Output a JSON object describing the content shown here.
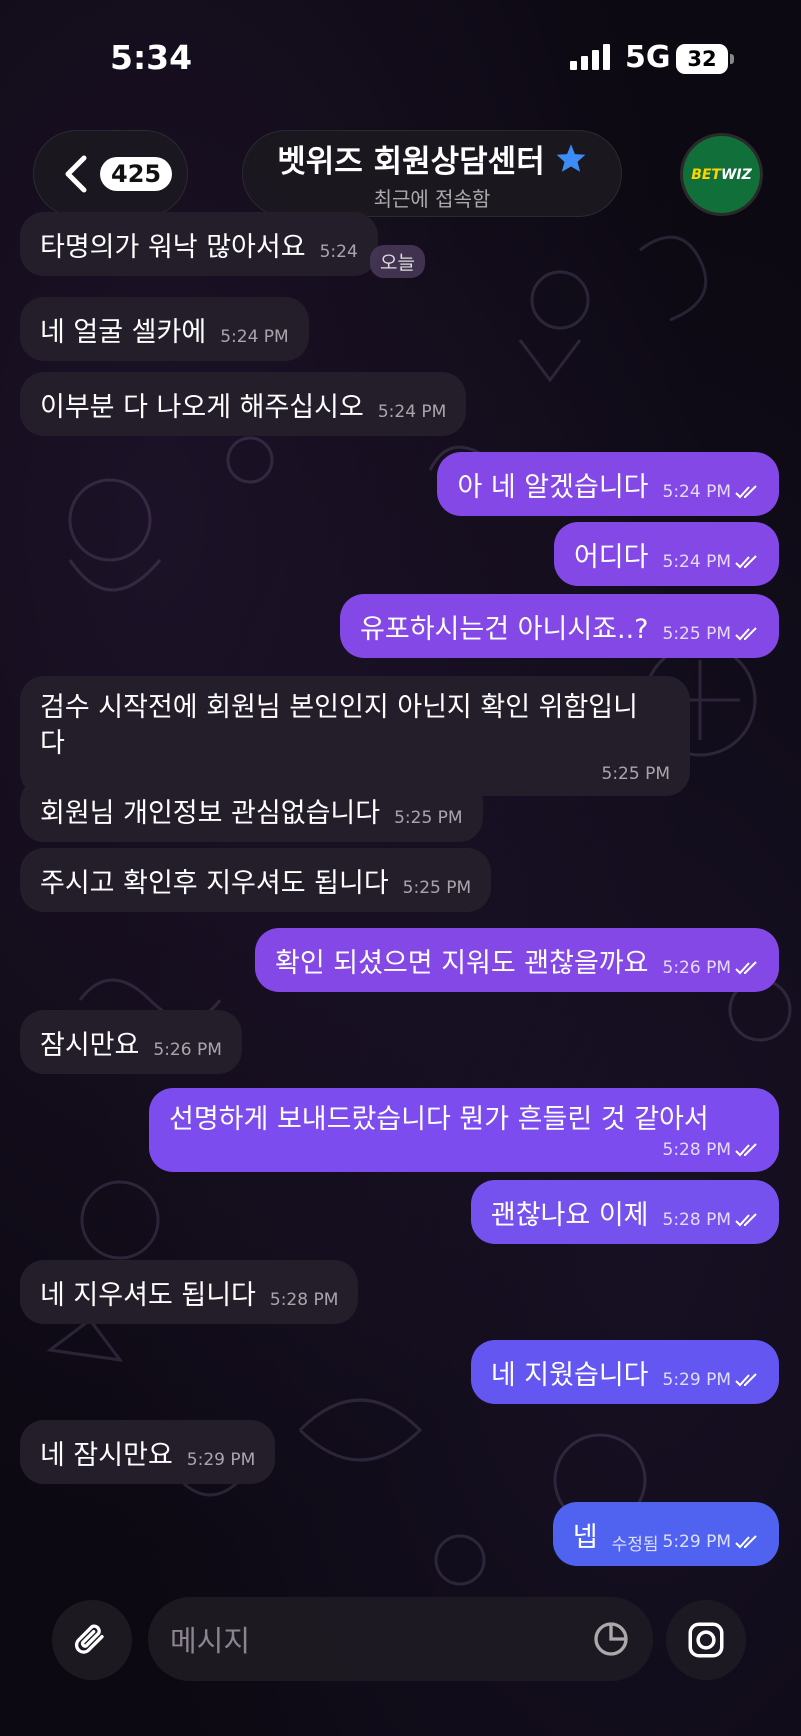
{
  "status_bar": {
    "time": "5:34",
    "network": "5G",
    "battery": "32"
  },
  "header": {
    "unread_count": "425",
    "title": "벳위즈 회원상담센터",
    "subtitle": "최근에 접속함",
    "avatar_text_1": "BET",
    "avatar_text_2": "WIZ"
  },
  "day_badge": "오늘",
  "messages": [
    {
      "dir": "in",
      "text": "타명의가 워낙 많아서요",
      "time": "5:24"
    },
    {
      "dir": "in",
      "text": "네 얼굴 셀카에",
      "time": "5:24 PM"
    },
    {
      "dir": "in",
      "text": "이부분 다 나오게 해주십시오",
      "time": "5:24 PM"
    },
    {
      "dir": "out",
      "text": "아 네 알겠습니다",
      "time": "5:24 PM"
    },
    {
      "dir": "out",
      "text": "어디다",
      "time": "5:24 PM"
    },
    {
      "dir": "out",
      "text": "유포하시는건 아니시죠..?",
      "time": "5:25 PM"
    },
    {
      "dir": "in",
      "text": "검수 시작전에 회원님 본인인지 아닌지 확인 위함입니",
      "text2": "다",
      "time": "5:25 PM"
    },
    {
      "dir": "in",
      "text": "회원님 개인정보 관심없습니다",
      "time": "5:25 PM"
    },
    {
      "dir": "in",
      "text": "주시고 확인후 지우셔도 됩니다",
      "time": "5:25 PM"
    },
    {
      "dir": "out",
      "text": "확인 되셨으면 지워도 괜찮을까요",
      "time": "5:26 PM"
    },
    {
      "dir": "in",
      "text": "잠시만요",
      "time": "5:26 PM"
    },
    {
      "dir": "out",
      "text": "선명하게 보내드랐습니다 뭔가 흔들린 것 같아서",
      "time": "5:28 PM"
    },
    {
      "dir": "out",
      "text": "괜찮나요 이제",
      "time": "5:28 PM"
    },
    {
      "dir": "in",
      "text": "네 지우셔도 됩니다",
      "time": "5:28 PM"
    },
    {
      "dir": "out",
      "text": "네 지웠습니다",
      "time": "5:29 PM"
    },
    {
      "dir": "in",
      "text": "네 잠시만요",
      "time": "5:29 PM"
    },
    {
      "dir": "out",
      "text": "넵",
      "edited": "수정됨",
      "time": "5:29 PM"
    }
  ],
  "composer": {
    "placeholder": "메시지"
  },
  "colors": {
    "outgoing": "#8448e6",
    "outgoing_last": "#4f63f0",
    "incoming": "#241e2b"
  },
  "icons": [
    "chevron-left-icon",
    "star-icon",
    "paperclip-icon",
    "sticker-icon",
    "camera-icon",
    "read-ticks-icon"
  ]
}
